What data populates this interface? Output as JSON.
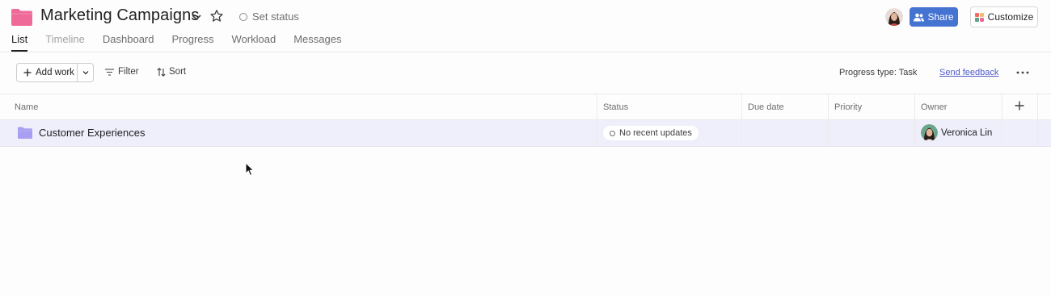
{
  "header": {
    "project_title": "Marketing Campaigns",
    "set_status": "Set status",
    "share_label": "Share",
    "customize_label": "Customize",
    "folder_color": "#f06a99",
    "share_color": "#4573d2"
  },
  "tabs": [
    {
      "label": "List",
      "active": true
    },
    {
      "label": "Timeline"
    },
    {
      "label": "Dashboard"
    },
    {
      "label": "Progress"
    },
    {
      "label": "Workload"
    },
    {
      "label": "Messages"
    }
  ],
  "toolbar": {
    "add_work": "Add work",
    "filter": "Filter",
    "sort": "Sort",
    "progress_type": "Progress type: Task",
    "send_feedback": "Send feedback"
  },
  "table": {
    "columns": {
      "name": "Name",
      "status": "Status",
      "due_date": "Due date",
      "priority": "Priority",
      "owner": "Owner"
    },
    "rows": [
      {
        "name": "Customer Experiences",
        "status": "No recent updates",
        "due_date": "",
        "priority": "",
        "owner": "Veronica Lin",
        "folder_color": "#a99ff2"
      }
    ]
  }
}
